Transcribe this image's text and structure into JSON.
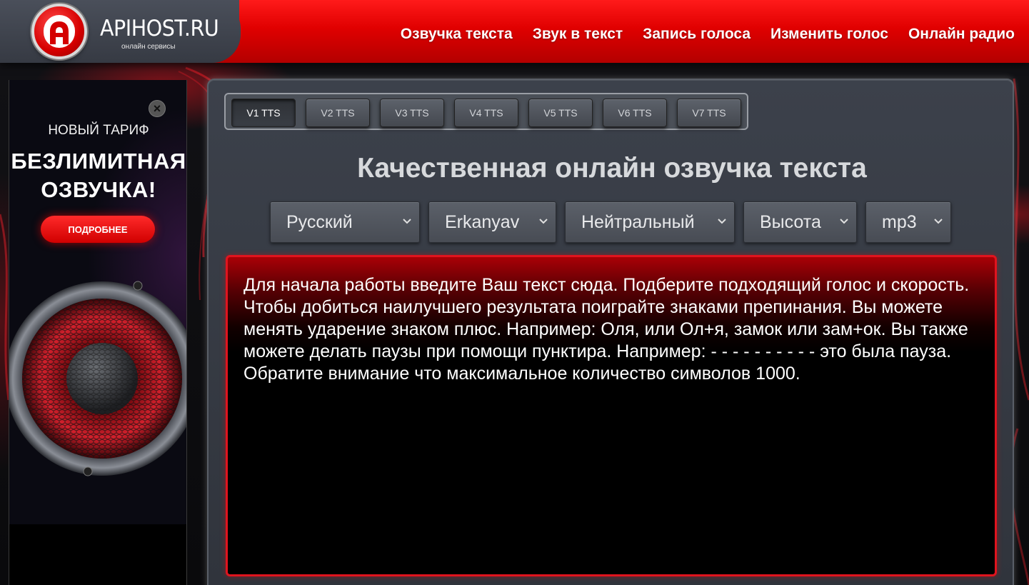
{
  "header": {
    "logo_text": "APIHOST.RU",
    "logo_subtitle": "онлайн сервисы",
    "nav": [
      {
        "label": "Озвучка текста"
      },
      {
        "label": "Звук в текст"
      },
      {
        "label": "Запись голоса"
      },
      {
        "label": "Изменить голос"
      },
      {
        "label": "Онлайн радио"
      }
    ]
  },
  "ad": {
    "close_symbol": "×",
    "tariff": "НОВЫЙ ТАРИФ",
    "headline_line1": "БЕЗЛИМИТНАЯ",
    "headline_line2": "ОЗВУЧКА!",
    "button_label": "ПОДРОБНЕЕ"
  },
  "main": {
    "tabs": [
      {
        "label": "V1 TTS",
        "active": true
      },
      {
        "label": "V2 TTS",
        "active": false
      },
      {
        "label": "V3 TTS",
        "active": false
      },
      {
        "label": "V4 TTS",
        "active": false
      },
      {
        "label": "V5 TTS",
        "active": false
      },
      {
        "label": "V6 TTS",
        "active": false
      },
      {
        "label": "V7 TTS",
        "active": false
      }
    ],
    "title": "Качественная онлайн озвучка текста",
    "selects": [
      {
        "value": "Русский"
      },
      {
        "value": "Erkanyav"
      },
      {
        "value": "Нейтральный"
      },
      {
        "value": "Высота"
      },
      {
        "value": "mp3"
      }
    ],
    "text": "Для начала работы введите Ваш текст сюда. Подберите подходящий голос и скорость. Чтобы добиться наилучшего результата поиграйте знаками препинания. Вы можете менять ударение знаком плюс. Например: Оля, или Ол+я, замок или зам+ок. Вы также можете делать паузы при помощи пунктира. Например: - - - - - - - - - - это была пауза. Обратите внимание что максимальное количество символов 1000."
  },
  "colors": {
    "accent_red": "#e00000",
    "panel": "#3c414b",
    "text_border": "#e0141e"
  },
  "icons": [
    "logo-a-icon",
    "close-icon",
    "chevron-down-icon",
    "speaker-image"
  ]
}
